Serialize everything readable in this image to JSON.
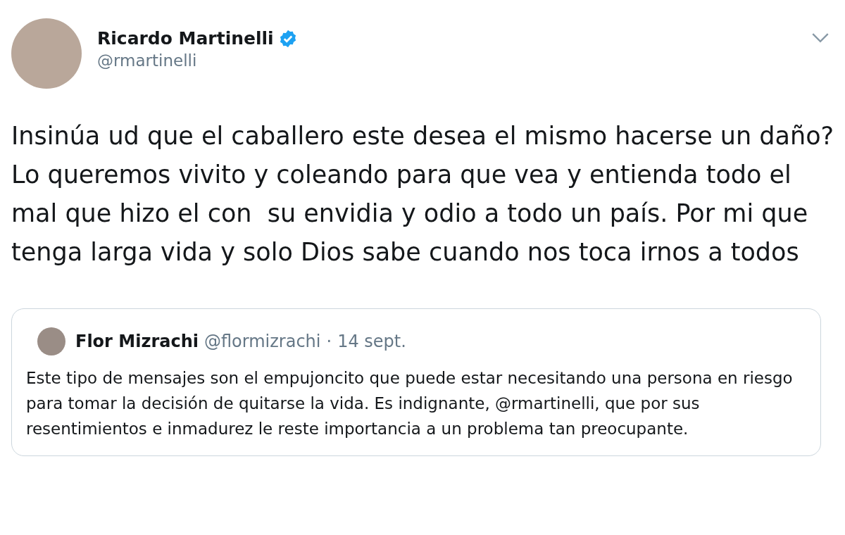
{
  "tweet": {
    "author": {
      "name": "Ricardo Martinelli",
      "verified": true,
      "handle": "@rmartinelli"
    },
    "text": "Insinúa ud que el caballero este desea el mismo hacerse un daño? Lo queremos vivito y coleando para que vea y entienda todo el mal que hizo el con  su envidia y odio a todo un país. Por mi que tenga larga vida y solo Dios sabe cuando nos toca irnos a todos",
    "quoted_tweet": {
      "author": {
        "name": "Flor Mizrachi",
        "handle": "@flormizrachi",
        "separator": "·",
        "date": "14 sept."
      },
      "text": "Este tipo de mensajes son el empujoncito que puede estar necesitando una persona en riesgo para tomar la decisión de quitarse la vida. Es indignante, @rmartinelli, que por sus resentimientos e inmadurez le reste importancia a un problema tan preocupante."
    }
  }
}
